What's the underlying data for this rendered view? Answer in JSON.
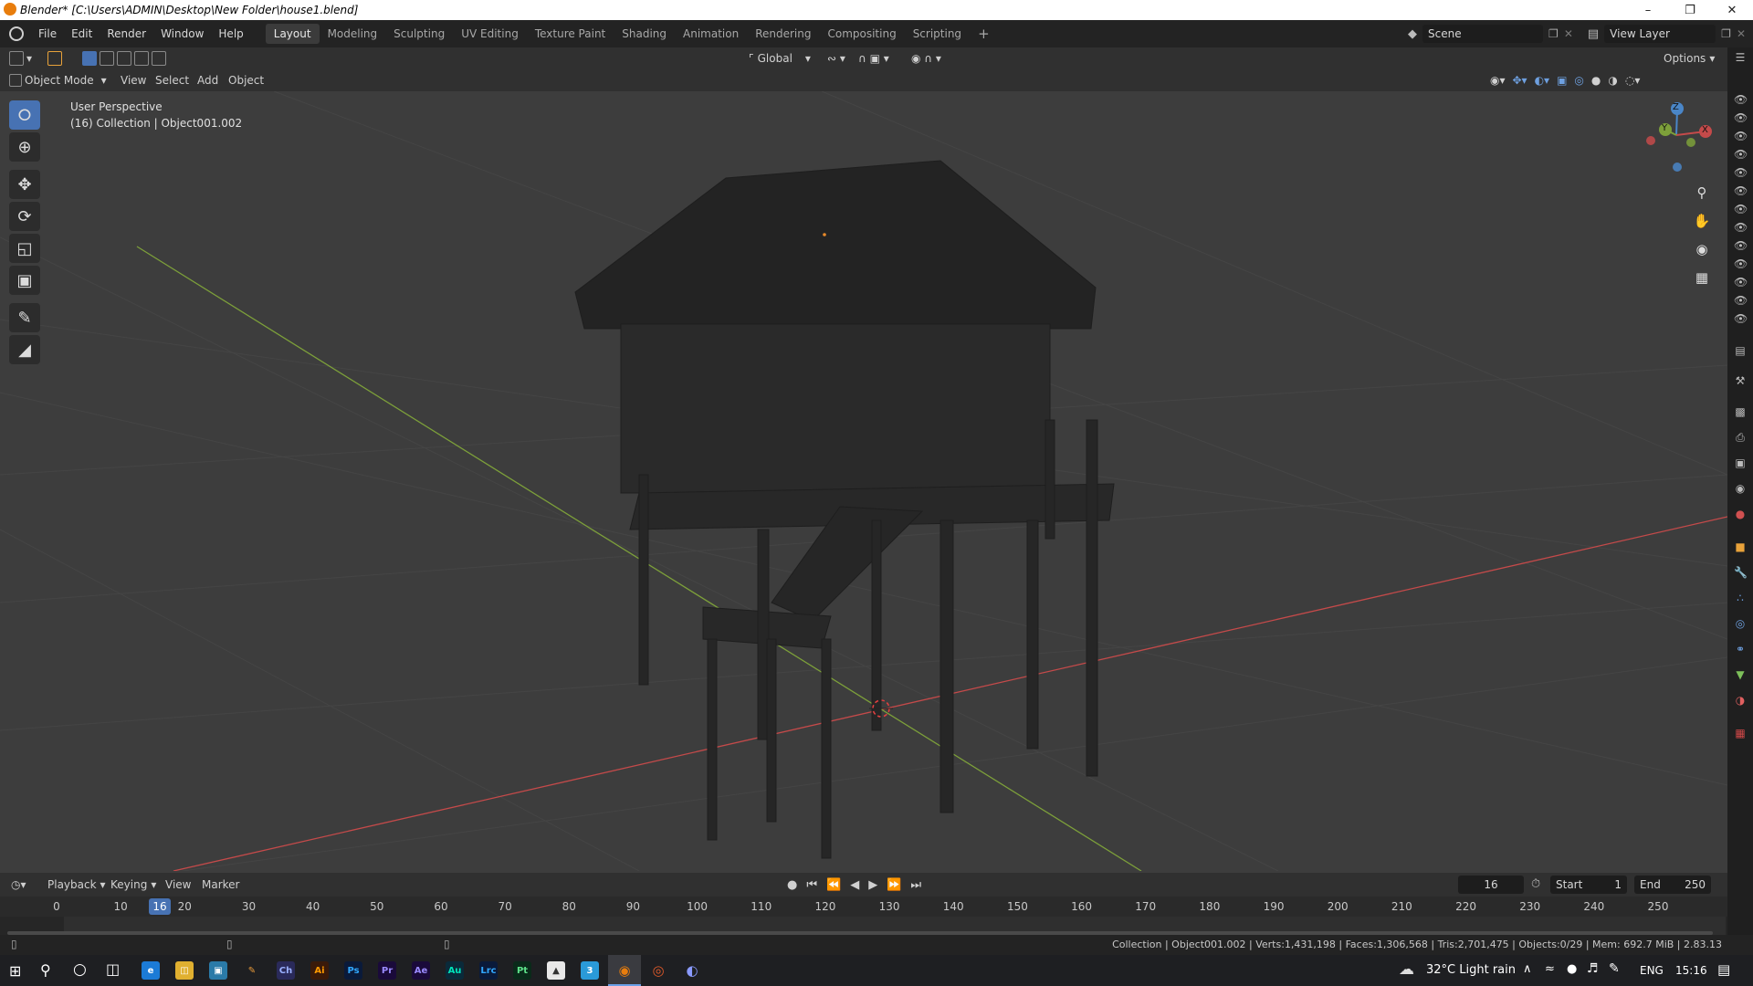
{
  "window": {
    "title": "Blender* [C:\\Users\\ADMIN\\Desktop\\New Folder\\house1.blend]",
    "minimize": "–",
    "maximize": "❐",
    "close": "✕"
  },
  "menu": [
    "File",
    "Edit",
    "Render",
    "Window",
    "Help"
  ],
  "workspaces": [
    {
      "label": "Layout",
      "active": true
    },
    {
      "label": "Modeling",
      "active": false
    },
    {
      "label": "Sculpting",
      "active": false
    },
    {
      "label": "UV Editing",
      "active": false
    },
    {
      "label": "Texture Paint",
      "active": false
    },
    {
      "label": "Shading",
      "active": false
    },
    {
      "label": "Animation",
      "active": false
    },
    {
      "label": "Rendering",
      "active": false
    },
    {
      "label": "Compositing",
      "active": false
    },
    {
      "label": "Scripting",
      "active": false
    }
  ],
  "add_workspace": "+",
  "scene_name": "Scene",
  "view_layer": "View Layer",
  "toolbar": {
    "transform_orientation": "Global",
    "options_label": "Options"
  },
  "viewport_header": {
    "mode": "Object Mode",
    "menus": [
      "View",
      "Select",
      "Add",
      "Object"
    ]
  },
  "viewport": {
    "perspective_label": "User Perspective",
    "collection_label": "(16) Collection | Object001.002",
    "gizmo": {
      "z": "Z",
      "y": "Y",
      "x": "X"
    }
  },
  "timeline": {
    "menus": [
      "Playback",
      "Keying",
      "View",
      "Marker"
    ],
    "current_frame": "16",
    "start_label": "Start",
    "start_value": "1",
    "end_label": "End",
    "end_value": "250",
    "ticks": [
      "0",
      "10",
      "20",
      "30",
      "40",
      "50",
      "60",
      "70",
      "80",
      "90",
      "100",
      "110",
      "120",
      "130",
      "140",
      "150",
      "160",
      "170",
      "180",
      "190",
      "200",
      "210",
      "220",
      "230",
      "240",
      "250"
    ]
  },
  "statusbar": {
    "stats": "Collection | Object001.002 | Verts:1,431,198 | Faces:1,306,568 | Tris:2,701,475 | Objects:0/29 | Mem: 692.7 MiB | 2.83.13"
  },
  "taskbar": {
    "apps": [
      "Ch",
      "Ai",
      "Ps",
      "Pr",
      "Ae",
      "Au",
      "Lrc",
      "Pt"
    ],
    "weather": "32°C  Light rain",
    "language": "ENG",
    "time": "15:16"
  },
  "colors": {
    "accent": "#4772b3",
    "x_axis": "#c44a4a",
    "y_axis": "#7da03a",
    "z_axis": "#4a86c8",
    "viewport_bg": "#3d3d3d"
  }
}
